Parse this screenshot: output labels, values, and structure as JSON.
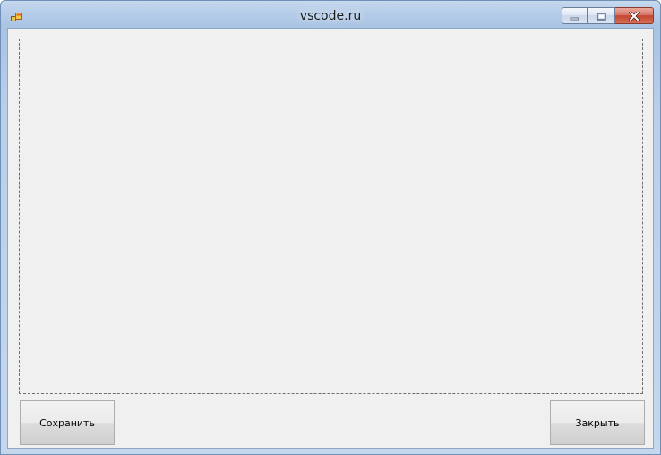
{
  "window": {
    "title": "vscode.ru",
    "app_icon": "winforms-app-icon",
    "caption_buttons": {
      "minimize_icon": "minimize-icon",
      "maximize_icon": "maximize-icon",
      "close_icon": "close-icon"
    }
  },
  "form": {
    "panel_icon": "none",
    "buttons": {
      "save_label": "Сохранить",
      "close_label": "Закрыть"
    }
  },
  "colors": {
    "close_button": "#c5452f",
    "client_background": "#f0f0f0",
    "frame": "#b6cde8"
  }
}
